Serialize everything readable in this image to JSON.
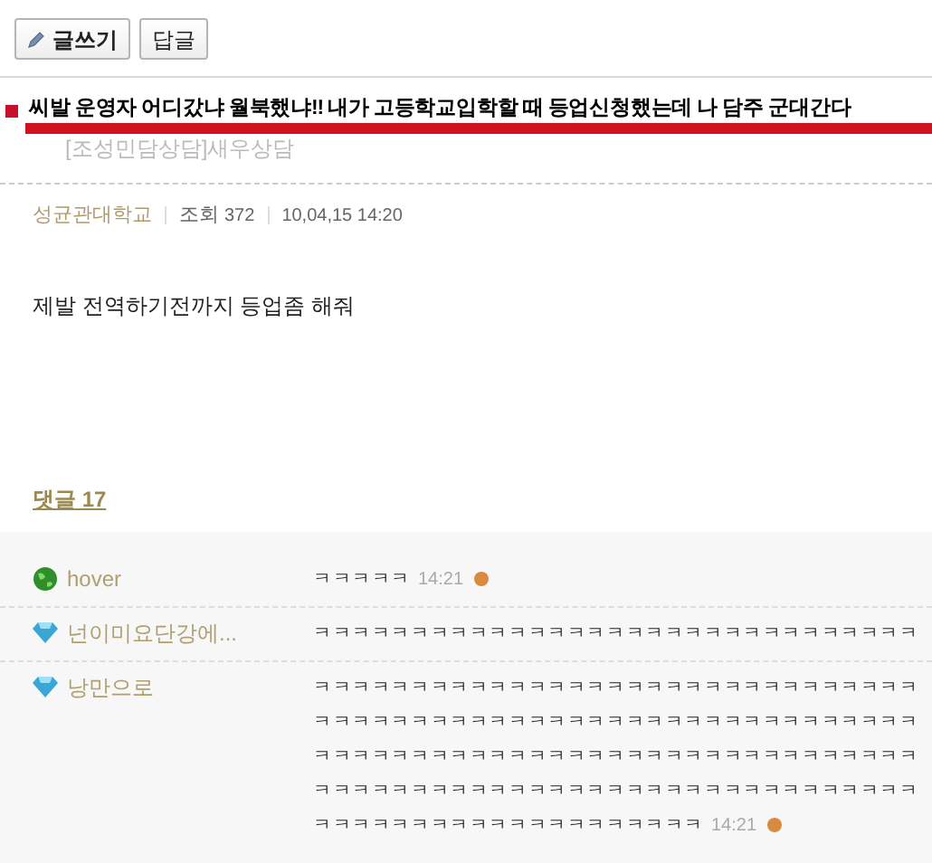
{
  "toolbar": {
    "buttons": [
      {
        "label": "글쓰기",
        "kind": "write"
      },
      {
        "label": "답글",
        "kind": "plain"
      }
    ]
  },
  "post": {
    "title": "씨발 운영자 어디갔냐 월북했냐!! 내가 고등학교입학할 때 등업신청했는데 나 담주 군대간다",
    "category": "[조성민담상담]새우상담",
    "author": "성균관대학교",
    "views_label": "조회",
    "views": "372",
    "date": "10,04,15 14:20",
    "body": "제발 전역하기전까지 등업좀 해줘"
  },
  "comments_header": "댓글 17",
  "comments": [
    {
      "author": "hover",
      "kind": "globe",
      "lines": [
        "ㅋㅋㅋㅋㅋ"
      ],
      "time": "14:21",
      "new": true
    },
    {
      "author": "넌이미요단강에...",
      "kind": "diamond",
      "lines": [
        "ㅋㅋㅋㅋㅋㅋㅋㅋㅋㅋㅋㅋㅋㅋㅋㅋㅋㅋㅋㅋㅋㅋㅋㅋㅋㅋㅋㅋㅋㅋㅋ"
      ],
      "new": false
    },
    {
      "author": "낭만으로",
      "kind": "diamond",
      "lines": [
        "ㅋㅋㅋㅋㅋㅋㅋㅋㅋㅋㅋㅋㅋㅋㅋㅋㅋㅋㅋㅋㅋㅋㅋㅋㅋㅋㅋㅋㅋㅋㅋ",
        "ㅋㅋㅋㅋㅋㅋㅋㅋㅋㅋㅋㅋㅋㅋㅋㅋㅋㅋㅋㅋㅋㅋㅋㅋㅋㅋㅋㅋㅋㅋㅋ",
        "ㅋㅋㅋㅋㅋㅋㅋㅋㅋㅋㅋㅋㅋㅋㅋㅋㅋㅋㅋㅋㅋㅋㅋㅋㅋㅋㅋㅋㅋㅋㅋ",
        "ㅋㅋㅋㅋㅋㅋㅋㅋㅋㅋㅋㅋㅋㅋㅋㅋㅋㅋㅋㅋㅋㅋㅋㅋㅋㅋㅋㅋㅋㅋㅋ",
        "ㅋㅋㅋㅋㅋㅋㅋㅋㅋㅋㅋㅋㅋㅋㅋㅋㅋㅋㅋㅋ"
      ],
      "time": "14:21",
      "new": true
    }
  ]
}
